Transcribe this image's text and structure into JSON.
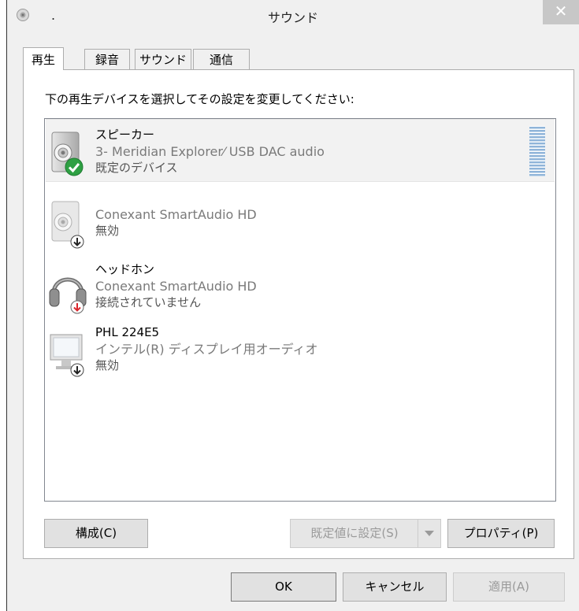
{
  "window": {
    "title": "サウンド",
    "title_prefix": ".",
    "close_glyph": "✕"
  },
  "tabs": [
    {
      "label": "再生",
      "active": true
    },
    {
      "label": "録音",
      "active": false
    },
    {
      "label": "サウンド",
      "active": false
    },
    {
      "label": "通信",
      "active": false
    }
  ],
  "instruction": "下の再生デバイスを選択してその設定を変更してください:",
  "devices": [
    {
      "name": "スピーカー",
      "description": "3- Meridian Explorer⁄ USB DAC audio",
      "status": "既定のデバイス",
      "icon": "speaker-icon",
      "badge": "default-check-icon",
      "selected": true
    },
    {
      "name": "",
      "description": "Conexant SmartAudio HD",
      "status": "無効",
      "icon": "speaker-icon",
      "badge": "disabled-arrow-icon",
      "selected": false
    },
    {
      "name": "ヘッドホン",
      "description": "Conexant SmartAudio HD",
      "status": "接続されていません",
      "icon": "headphones-icon",
      "badge": "unplugged-arrow-icon",
      "selected": false
    },
    {
      "name": "PHL 224E5",
      "description": "インテル(R) ディスプレイ用オーディオ",
      "status": "無効",
      "icon": "monitor-icon",
      "badge": "disabled-arrow-icon",
      "selected": false
    }
  ],
  "buttons": {
    "configure": "構成(C)",
    "set_default": "既定値に設定(S)",
    "properties": "プロパティ(P)",
    "ok": "OK",
    "cancel": "キャンセル",
    "apply": "適用(A)"
  },
  "colors": {
    "accent_check": "#2ea043",
    "unplugged_arrow": "#d9262c",
    "meter": "#8fb4d9"
  }
}
